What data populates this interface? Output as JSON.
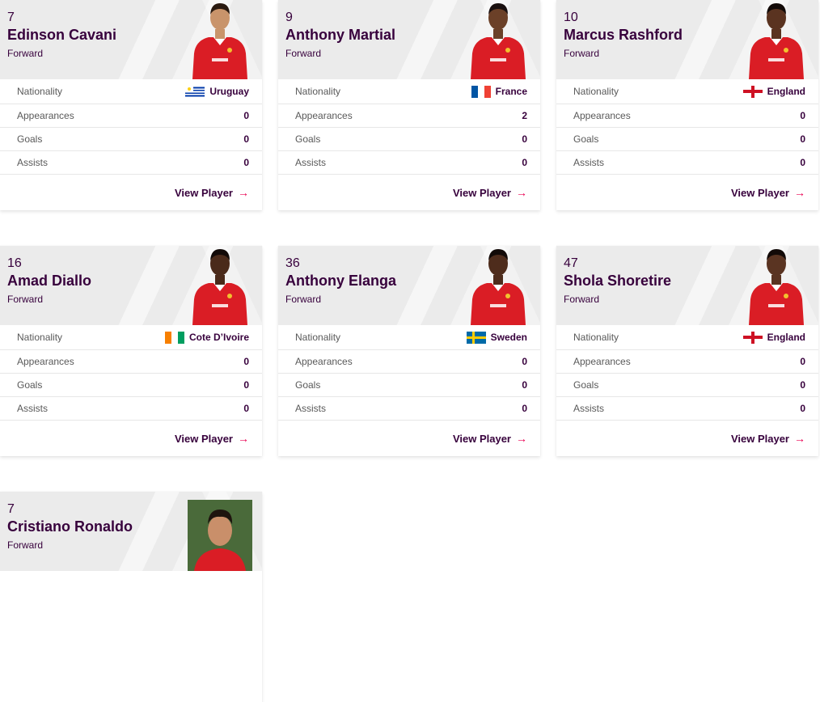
{
  "labels": {
    "nationality": "Nationality",
    "appearances": "Appearances",
    "goals": "Goals",
    "assists": "Assists",
    "view_player": "View Player",
    "arrow": "→"
  },
  "players": [
    {
      "number": "7",
      "name": "Edinson Cavani",
      "position": "Forward",
      "nationality": "Uruguay",
      "flag": "uruguay-flag",
      "appearances": "0",
      "goals": "0",
      "assists": "0",
      "skin": "#c9946b",
      "hair": "#2a1a10"
    },
    {
      "number": "9",
      "name": "Anthony Martial",
      "position": "Forward",
      "nationality": "France",
      "flag": "france-flag",
      "appearances": "2",
      "goals": "0",
      "assists": "0",
      "skin": "#6b4028",
      "hair": "#1a1010"
    },
    {
      "number": "10",
      "name": "Marcus Rashford",
      "position": "Forward",
      "nationality": "England",
      "flag": "england-flag",
      "appearances": "0",
      "goals": "0",
      "assists": "0",
      "skin": "#5a3320",
      "hair": "#120a08"
    },
    {
      "number": "16",
      "name": "Amad Diallo",
      "position": "Forward",
      "nationality": "Cote D’Ivoire",
      "flag": "ivory-coast-flag",
      "appearances": "0",
      "goals": "0",
      "assists": "0",
      "skin": "#4a2a1a",
      "hair": "#120a08"
    },
    {
      "number": "36",
      "name": "Anthony Elanga",
      "position": "Forward",
      "nationality": "Sweden",
      "flag": "sweden-flag",
      "appearances": "0",
      "goals": "0",
      "assists": "0",
      "skin": "#4e2c1c",
      "hair": "#120a08"
    },
    {
      "number": "47",
      "name": "Shola Shoretire",
      "position": "Forward",
      "nationality": "England",
      "flag": "england-flag",
      "appearances": "0",
      "goals": "0",
      "assists": "0",
      "skin": "#5a3422",
      "hair": "#120a08"
    },
    {
      "number": "7",
      "name": "Cristiano Ronaldo",
      "position": "Forward",
      "nationality": "",
      "flag": "",
      "appearances": "",
      "goals": "",
      "assists": "",
      "skin": "#c98f6a",
      "hair": "#1e140e"
    }
  ],
  "colors": {
    "primary": "#37003c",
    "accent": "#e90052",
    "shirt_red": "#da1d25",
    "card_header": "#ebebeb"
  }
}
